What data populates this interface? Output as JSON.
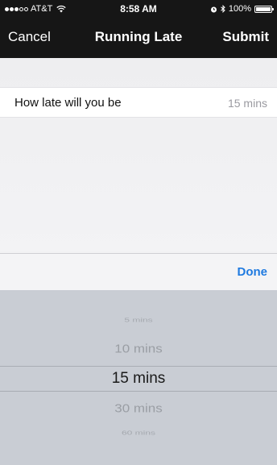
{
  "status_bar": {
    "carrier": "AT&T",
    "time": "8:58 AM",
    "battery": "100%",
    "battery_level": 1.0,
    "signal_bars_filled": 3,
    "signal_bars_total": 5
  },
  "nav": {
    "cancel_label": "Cancel",
    "title": "Running Late",
    "submit_label": "Submit"
  },
  "form": {
    "label": "How late will you be",
    "value": "15 mins"
  },
  "picker": {
    "done_label": "Done",
    "options": [
      "5 mins",
      "10 mins",
      "15 mins",
      "30 mins",
      "60 mins"
    ],
    "selected_index": 2
  },
  "colors": {
    "header_bg": "#161616",
    "accent": "#1f7ae0",
    "picker_bg": "#c9cdd4"
  }
}
